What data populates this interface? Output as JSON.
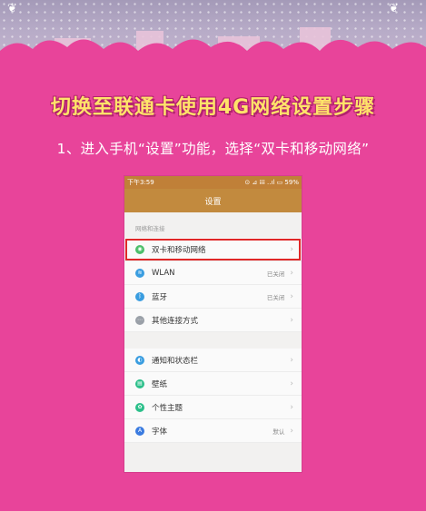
{
  "headline": "切换至联通卡使用4G网络设置步骤",
  "step_text": "1、进入手机“设置”功能，选择“双卡和移动网络”",
  "phone": {
    "status_time": "下午3:59",
    "status_icons": "⊙ ⊿ 𝍖 ..ıl ▭ 59%",
    "title": "设置",
    "section_label": "网络和连接",
    "group1": [
      {
        "icon": "sim-card-icon",
        "color": "#4cbf6a",
        "label": "双卡和移动网络",
        "value": "",
        "highlighted": true
      },
      {
        "icon": "wifi-icon",
        "color": "#3a9de0",
        "label": "WLAN",
        "value": "已关闭"
      },
      {
        "icon": "bluetooth-icon",
        "color": "#3a9de0",
        "label": "蓝牙",
        "value": "已关闭"
      },
      {
        "icon": "more-connections-icon",
        "color": "#9aa0a8",
        "label": "其他连接方式",
        "value": ""
      }
    ],
    "group2": [
      {
        "icon": "notification-icon",
        "color": "#3a9de0",
        "label": "通知和状态栏",
        "value": ""
      },
      {
        "icon": "wallpaper-icon",
        "color": "#2bbf8a",
        "label": "壁纸",
        "value": ""
      },
      {
        "icon": "theme-icon",
        "color": "#2bbf8a",
        "label": "个性主题",
        "value": ""
      },
      {
        "icon": "font-icon",
        "color": "#3a7be0",
        "label": "字体",
        "value": "默认"
      }
    ]
  }
}
